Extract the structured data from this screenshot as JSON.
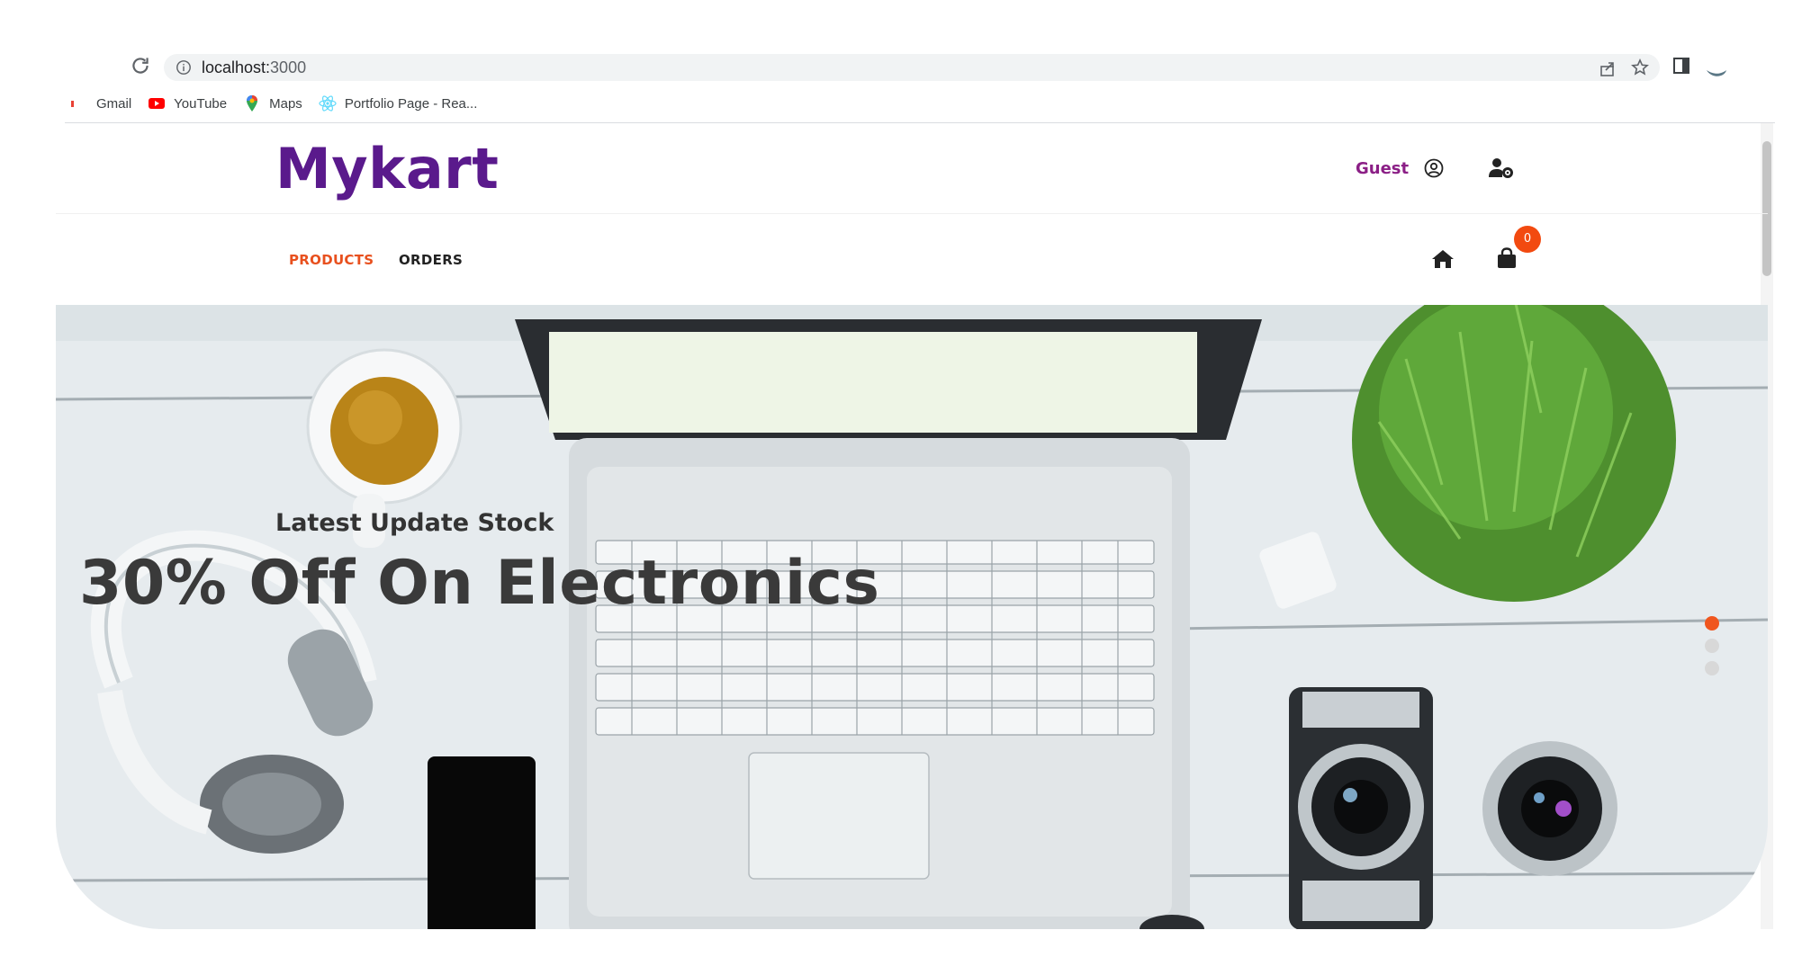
{
  "browser": {
    "url_host": "localhost:",
    "url_port": "3000",
    "bookmarks": [
      {
        "label": "Gmail",
        "icon": "gmail-icon"
      },
      {
        "label": "YouTube",
        "icon": "youtube-icon"
      },
      {
        "label": "Maps",
        "icon": "maps-icon"
      },
      {
        "label": "Portfolio Page - Rea...",
        "icon": "react-icon"
      }
    ]
  },
  "header": {
    "logo": "Mykart",
    "user_label": "Guest"
  },
  "nav": {
    "products": "PRODUCTS",
    "orders": "ORDERS",
    "cart_count": "0"
  },
  "hero": {
    "subtitle": "Latest Update Stock",
    "title": "30% Off On Electronics",
    "slides": 3,
    "active_slide": 1
  },
  "colors": {
    "brand": "#5a1a8c",
    "accent": "#f0561e",
    "guest": "#8b1f86"
  }
}
